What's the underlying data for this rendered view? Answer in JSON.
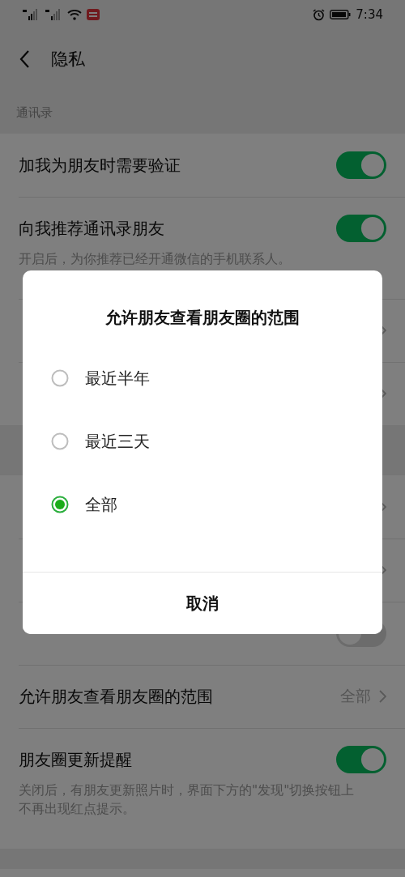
{
  "status_bar": {
    "time": "7:34"
  },
  "nav": {
    "title": "隐私"
  },
  "sections": [
    {
      "header": "通讯录",
      "rows": [
        {
          "kind": "toggle",
          "label": "加我为朋友时需要验证",
          "on": true
        },
        {
          "kind": "toggle",
          "label": "向我推荐通讯录朋友",
          "on": true,
          "description": "开启后，为你推荐已经开通微信的手机联系人。"
        },
        {
          "kind": "link"
        },
        {
          "kind": "link"
        }
      ]
    },
    {
      "rows": [
        {
          "kind": "link"
        },
        {
          "kind": "link"
        },
        {
          "kind": "toggle",
          "on": false
        },
        {
          "kind": "link",
          "label": "允许朋友查看朋友圈的范围",
          "value": "全部"
        },
        {
          "kind": "toggle",
          "label": "朋友圈更新提醒",
          "on": true,
          "description": "关闭后，有朋友更新照片时，界面下方的\"发现\"切换按钮上不再出现红点提示。"
        }
      ]
    }
  ],
  "dialog": {
    "title": "允许朋友查看朋友圈的范围",
    "options": [
      {
        "label": "最近半年",
        "selected": false
      },
      {
        "label": "最近三天",
        "selected": false
      },
      {
        "label": "全部",
        "selected": true
      }
    ],
    "cancel": "取消"
  }
}
